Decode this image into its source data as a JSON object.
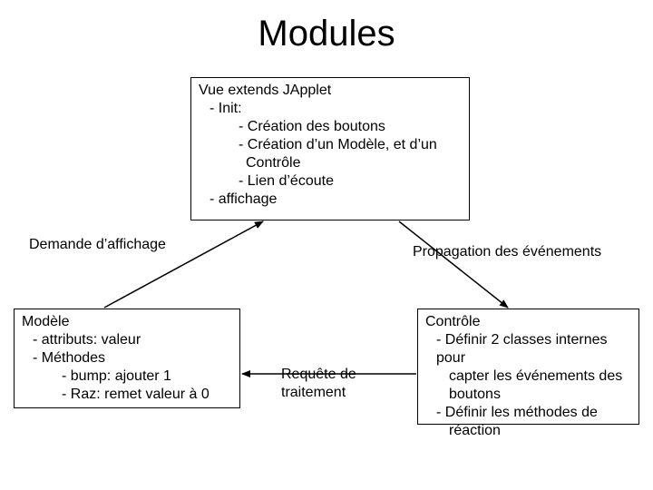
{
  "title": "Modules",
  "vue": {
    "h": "Vue extends JApplet",
    "l1": "-  Init:",
    "l2": "- Création des boutons",
    "l3": "- Création d’un Modèle, et d’un",
    "l3b": "Contrôle",
    "l4": "- Lien d’écoute",
    "l5": "-  affichage"
  },
  "modele": {
    "h": "Modèle",
    "l1": "-  attributs: valeur",
    "l2": "-  Méthodes",
    "l3": "- bump: ajouter 1",
    "l4": "- Raz: remet valeur à 0"
  },
  "controle": {
    "h": "Contrôle",
    "l1": "-  Définir 2 classes internes pour",
    "l1b": "capter les événements des",
    "l1c": "boutons",
    "l2": "-  Définir les méthodes de",
    "l2b": "réaction"
  },
  "labels": {
    "demande": "Demande d’affichage",
    "propagation": "Propagation des événements",
    "requete_l1": "Requête de",
    "requete_l2": "traitement"
  }
}
